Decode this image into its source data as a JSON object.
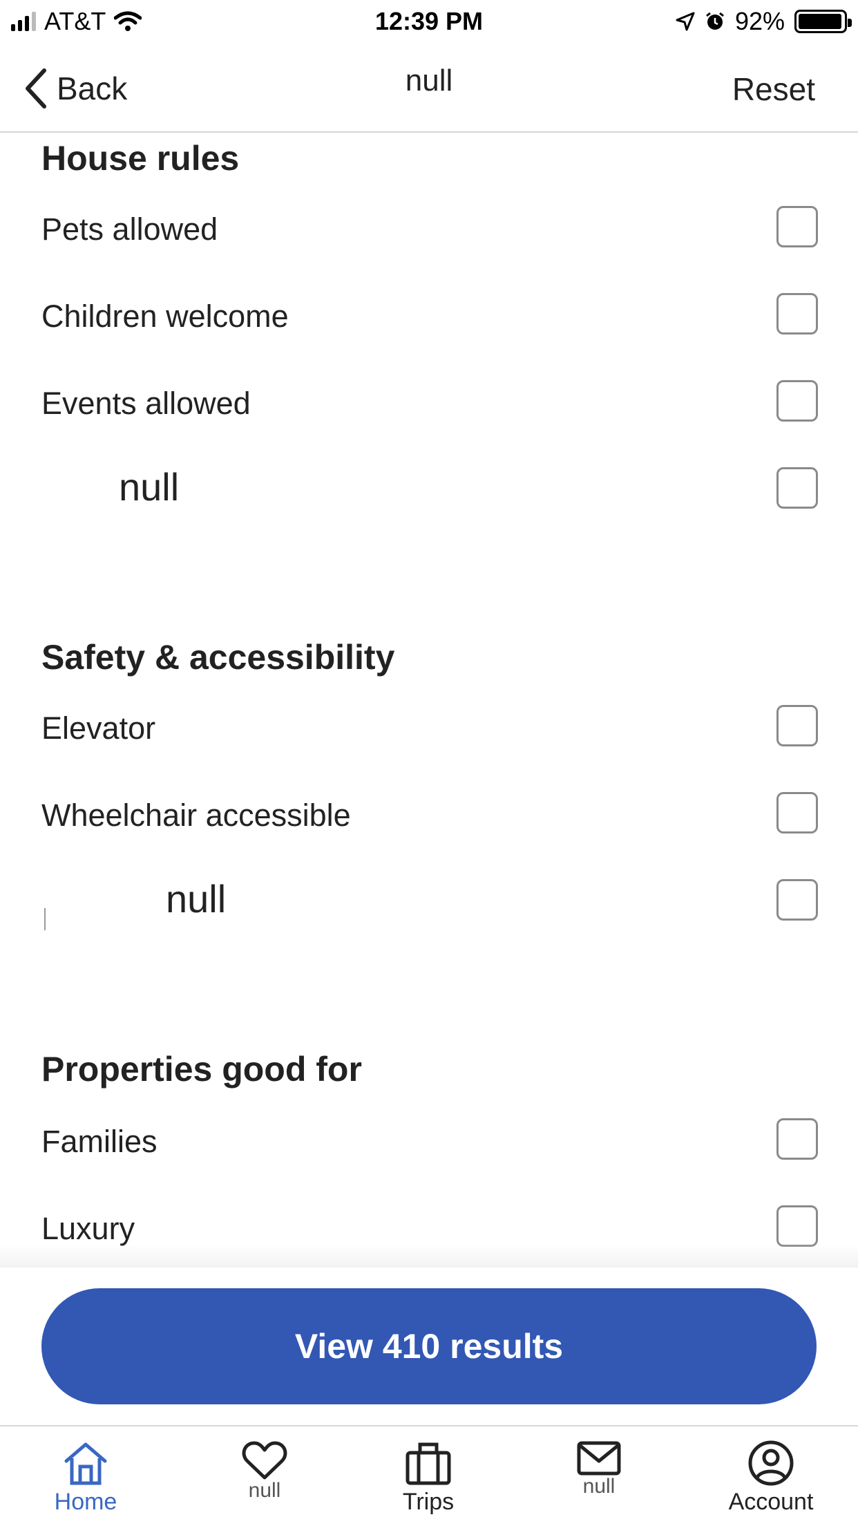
{
  "status_bar": {
    "carrier": "AT&T",
    "time": "12:39 PM",
    "battery": "92%",
    "icons": [
      "signal-icon",
      "wifi-icon",
      "location-icon",
      "alarm-icon",
      "battery-icon"
    ]
  },
  "nav": {
    "back_label": "Back",
    "title": "null",
    "reset_label": "Reset"
  },
  "sections": {
    "house_rules": {
      "title": "House rules",
      "items": [
        "Pets allowed",
        "Children welcome",
        "Events allowed",
        "null"
      ]
    },
    "safety": {
      "title": "Safety & accessibility",
      "items": [
        "Elevator",
        "Wheelchair accessible",
        "null"
      ]
    },
    "good_for": {
      "title": "Properties good for",
      "items": [
        "Families",
        "Luxury"
      ]
    }
  },
  "cta": {
    "label": "View 410 results"
  },
  "tabbar": {
    "items": [
      {
        "label": "Home",
        "icon": "home-icon"
      },
      {
        "label": "null",
        "icon": "heart-icon"
      },
      {
        "label": "Trips",
        "icon": "suitcase-icon"
      },
      {
        "label": "null",
        "icon": "mail-icon"
      },
      {
        "label": "Account",
        "icon": "account-icon"
      }
    ]
  },
  "colors": {
    "accent": "#3258b4",
    "active_tab": "#3a67c4",
    "checkbox_border": "#8a8a8a"
  }
}
